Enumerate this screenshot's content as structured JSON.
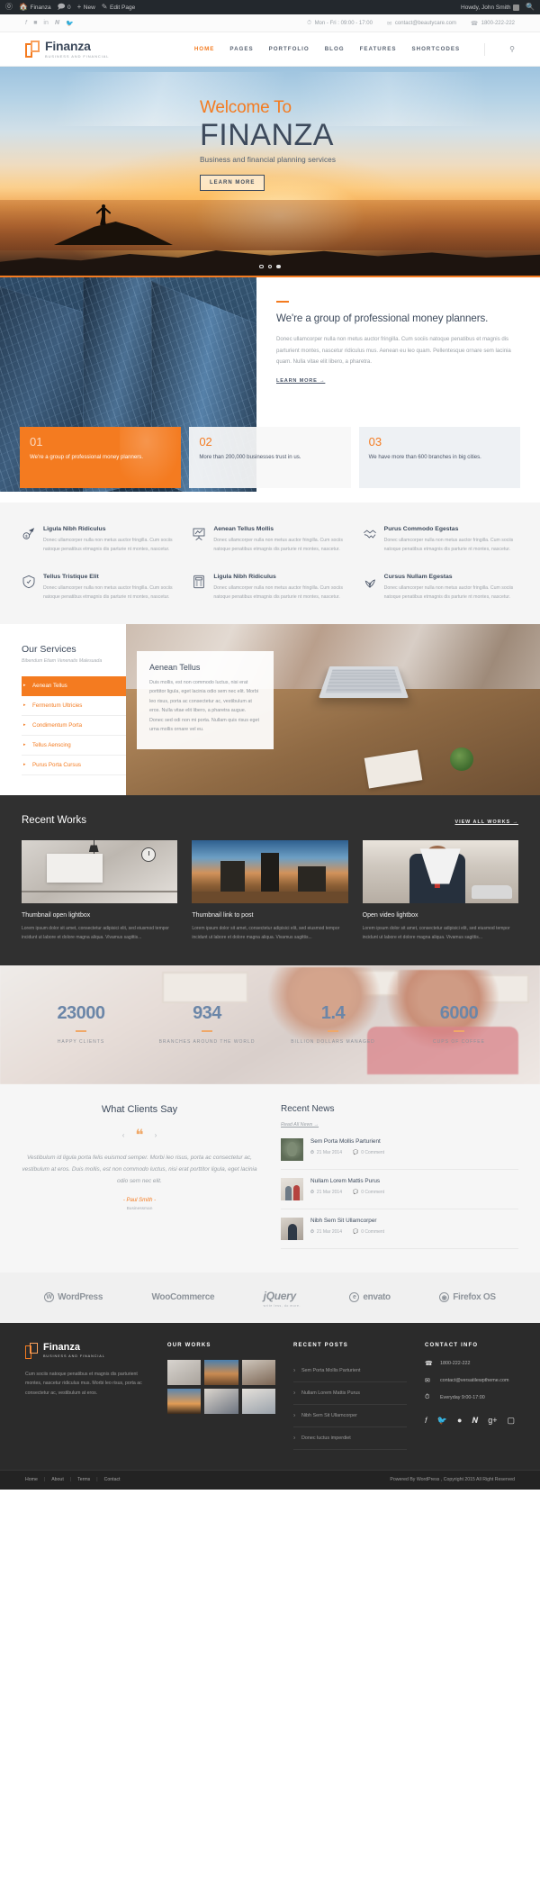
{
  "adminbar": {
    "wp_icon": "wordpress-icon",
    "site_name": "Finanza",
    "comments_count": "0",
    "new_label": "New",
    "edit_label": "Edit Page",
    "howdy": "Howdy, John Smith",
    "search_icon": "search-icon"
  },
  "topbar": {
    "socials": [
      "facebook-icon",
      "flickr-icon",
      "linkedin-icon",
      "pinterest-icon",
      "twitter-icon"
    ],
    "hours": "Mon - Fri : 09:00 - 17:00",
    "email": "contact@beautycare.com",
    "phone": "1800-222-222"
  },
  "header": {
    "logo_name": "Finanza",
    "logo_tagline": "BUSINESS AND FINANCIAL",
    "nav": [
      {
        "label": "HOME",
        "active": true
      },
      {
        "label": "PAGES",
        "active": false
      },
      {
        "label": "PORTFOLIO",
        "active": false
      },
      {
        "label": "BLOG",
        "active": false
      },
      {
        "label": "FEATURES",
        "active": false
      },
      {
        "label": "SHORTCODES",
        "active": false
      }
    ],
    "search_icon": "search-icon"
  },
  "hero": {
    "welcome": "Welcome To",
    "title": "FINANZA",
    "subtitle": "Business and financial planning services",
    "button": "LEARN MORE",
    "dots": 3,
    "active_dot": 3
  },
  "about": {
    "heading": "We're a group of professional money planners.",
    "body": "Donec ullamcorper nulla non metus auctor fringilla. Cum sociis natoque penatibus et magnis dis parturient montes, nascetur ridiculus mus. Aenean eu leo quam. Pellentesque ornare sem lacinia quam. Nulla vitae elit libero, a pharetra.",
    "link": "LEARN MORE →"
  },
  "promos": [
    {
      "num": "01",
      "text": "We're a group of professional money planners."
    },
    {
      "num": "02",
      "text": "More than 200,000 businesses trust in us."
    },
    {
      "num": "03",
      "text": "We have more than 600 branches in big cities."
    }
  ],
  "features": [
    {
      "icon": "money-flag-icon",
      "title": "Ligula Nibh Ridiculus",
      "text": "Donec ullamcorper nulla non metus auctor fringilla. Cum sociis natoque penatibus etmagnis dis parturie nt montes, nascetur."
    },
    {
      "icon": "presentation-chart-icon",
      "title": "Aenean Tellus Mollis",
      "text": "Donec ullamcorper nulla non metus auctor fringilla. Cum sociis natoque penatibus etmagnis dis parturie nt montes, nascetur."
    },
    {
      "icon": "handshake-icon",
      "title": "Purus Commodo Egestas",
      "text": "Donec ullamcorper nulla non metus auctor fringilla. Cum sociis natoque penatibus etmagnis dis parturie nt montes, nascetur."
    },
    {
      "icon": "shield-icon",
      "title": "Tellus Tristique Elit",
      "text": "Donec ullamcorper nulla non metus auctor fringilla. Cum sociis natoque penatibus etmagnis dis parturie nt montes, nascetur."
    },
    {
      "icon": "calculator-icon",
      "title": "Ligula Nibh Ridiculus",
      "text": "Donec ullamcorper nulla non metus auctor fringilla. Cum sociis natoque penatibus etmagnis dis parturie nt montes, nascetur."
    },
    {
      "icon": "idea-growth-icon",
      "title": "Cursus Nullam Egestas",
      "text": "Donec ullamcorper nulla non metus auctor fringilla. Cum sociis natoque penatibus etmagnis dis parturie nt montes, nascetur."
    }
  ],
  "services": {
    "heading": "Our Services",
    "subheading": "Bibendum Etiam Venenatis Malesuada",
    "tabs": [
      {
        "label": "Aenean Tellus",
        "active": true
      },
      {
        "label": "Fermentum Ultricies",
        "active": false
      },
      {
        "label": "Condimentum Porta",
        "active": false
      },
      {
        "label": "Tellus Aenscing",
        "active": false
      },
      {
        "label": "Purus Porta Cursus",
        "active": false
      }
    ],
    "panel_title": "Aenean Tellus",
    "panel_body": "Duis mollis, est non commodo luctus, nisi erat porttitor ligula, eget lacinia odio sem nec elit. Morbi leo risus, porta ac consectetur ac, vestibulum at eros. Nulla vitae elit libero, a pharetra augue. Donec sed odi non mi porta. Nullam quis risus eget urna mollis ornare vel eu."
  },
  "works": {
    "heading": "Recent Works",
    "view_all": "VIEW ALL WORKS →",
    "items": [
      {
        "title": "Thumbnail open lightbox",
        "text": "Lorem ipsum dolor sit amet, consectetur adipisici elit, sed eiusmod tempor incidunt ut labore et dolore magna aliqua. Vivamus sagittis..."
      },
      {
        "title": "Thumbnail link to post",
        "text": "Lorem ipsum dolor sit amet, consectetur adipisici elit, sed eiusmod tempor incidunt ut labore et dolore magna aliqua. Vivamus sagittis..."
      },
      {
        "title": "Open video lightbox",
        "text": "Lorem ipsum dolor sit amet, consectetur adipisici elit, sed eiusmod tempor incidunt ut labore et dolore magna aliqua. Vivamus sagittis..."
      }
    ]
  },
  "counters": [
    {
      "value": "23000",
      "label": "HAPPY CLIENTS"
    },
    {
      "value": "934",
      "label": "BRANCHES AROUND THE WORLD"
    },
    {
      "value": "1.4",
      "label": "BILLION DOLLARS MANAGED"
    },
    {
      "value": "6000",
      "label": "CUPS OF COFFEE"
    }
  ],
  "testimonial": {
    "heading": "What Clients Say",
    "prev_icon": "chevron-left-icon",
    "next_icon": "chevron-right-icon",
    "quote_icon": "quote-icon",
    "body": "Vestibulum id ligula porta felis euismod semper. Morbi leo risus, porta ac consectetur ac, vestibulum at eros. Duis mollis, est non commodo luctus, nisi erat porttitor ligula, eget lacinia odio sem nec elit.",
    "author": "- Paul Smith -",
    "role": "Businessman"
  },
  "news": {
    "heading": "Recent News",
    "read_all": "Read All News →",
    "items": [
      {
        "title": "Sem Porta Mollis Parturient",
        "date": "21 Mar 2014",
        "comments": "0 Comment"
      },
      {
        "title": "Nullam Lorem Mattis Purus",
        "date": "21 Mar 2014",
        "comments": "0 Comment"
      },
      {
        "title": "Nibh Sem Sit Ullamcorper",
        "date": "21 Mar 2014",
        "comments": "0 Comment"
      }
    ]
  },
  "brands": [
    {
      "name": "WordPress",
      "sub": ""
    },
    {
      "name": "WooCommerce",
      "sub": ""
    },
    {
      "name": "jQuery",
      "sub": "write less, do more."
    },
    {
      "name": "envato",
      "sub": ""
    },
    {
      "name": "Firefox OS",
      "sub": ""
    }
  ],
  "footer": {
    "logo_name": "Finanza",
    "logo_tagline": "BUSINESS AND FINANCIAL",
    "about": "Cum sociis natoque penatibus et magnis dis parturient montes, nascetur ridiculus mus. Morbi leo risus, porta ac consectetur ac, vestibulum at eros.",
    "works_heading": "OUR WORKS",
    "posts_heading": "RECENT POSTS",
    "posts": [
      "Sem Porta Mollis Parturient",
      "Nullam Lorem Mattis Purus",
      "Nibh Sem Sit Ullamcorper",
      "Donec luctus imperdiet"
    ],
    "contact_heading": "CONTACT INFO",
    "phone": "1800-222-222",
    "email": "contact@versatilewptheme.com",
    "hours": "Everyday 9:00-17:00",
    "socials": [
      "facebook-icon",
      "twitter-icon",
      "dribbble-icon",
      "pinterest-icon",
      "google-plus-icon",
      "instagram-icon"
    ],
    "bottom_links": [
      "Home",
      "About",
      "Terms",
      "Contact"
    ],
    "copyright": "Powered By WordPress , Copyright 2015 All Right Reserved"
  }
}
